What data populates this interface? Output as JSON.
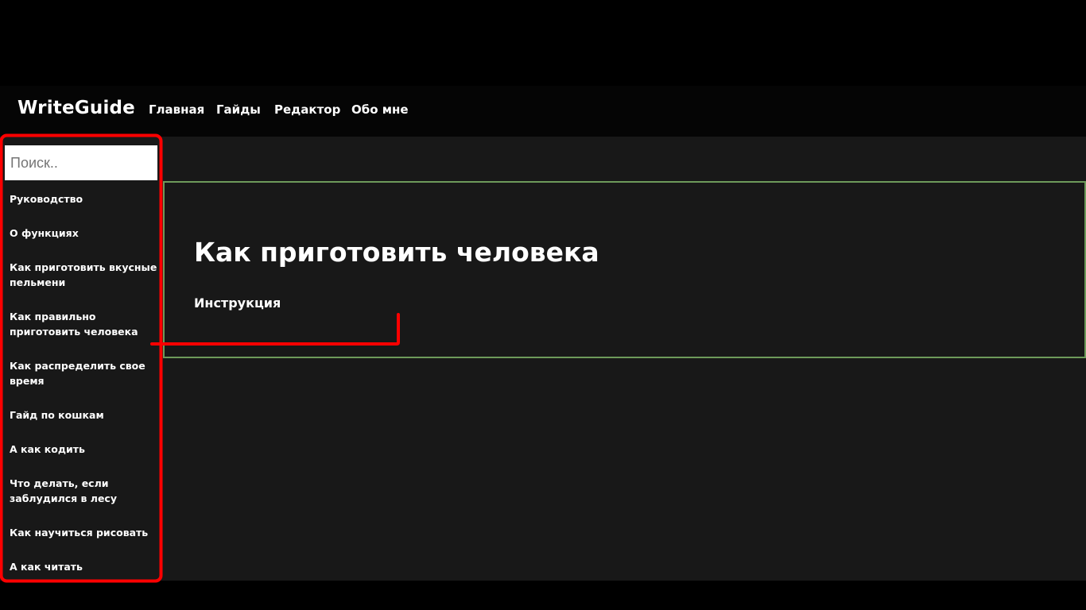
{
  "header": {
    "brand": "WriteGuide",
    "nav": [
      "Главная",
      "Гайды",
      "Редактор",
      "Обо мне"
    ]
  },
  "sidebar": {
    "search_placeholder": "Поиск..",
    "items": [
      "Руководство",
      "О функциях",
      "Как приготовить вкусные пельмени",
      "Как правильно приготовить человека",
      "Как распределить свое время",
      "Гайд по кошкам",
      "А как кодить",
      "Что делать, если заблудился в лесу",
      "Как научиться рисовать",
      "А как читать"
    ]
  },
  "main": {
    "title": "Как приготовить человека",
    "subtitle": "Инструкция"
  },
  "colors": {
    "background": "#000000",
    "content_background": "#181818",
    "card_border": "#6d9a5a",
    "annotation": "#ff0000"
  }
}
